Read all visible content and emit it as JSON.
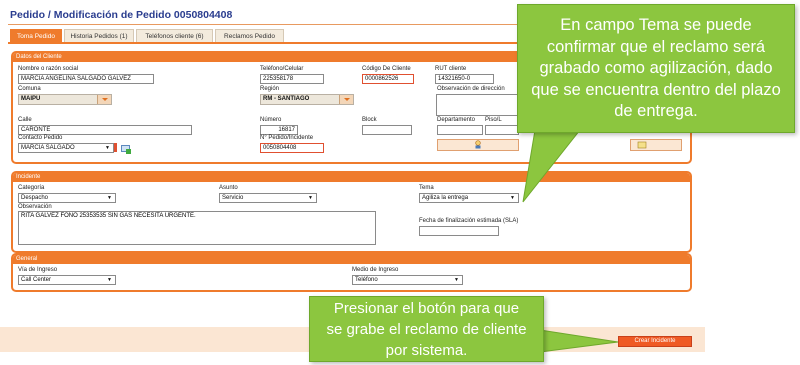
{
  "header": {
    "title": "Pedido / Modificación de Pedido 0050804408"
  },
  "tabs": [
    {
      "label": "Toma Pedido",
      "active": true
    },
    {
      "label": "Historia Pedidos (1)",
      "active": false
    },
    {
      "label": "Teléfonos cliente (6)",
      "active": false
    },
    {
      "label": "Reclamos Pedido",
      "active": false
    }
  ],
  "datos_cliente": {
    "section_title": "Datos del Cliente",
    "nombre_label": "Nombre o razón social",
    "nombre_value": "MARCIA ANGELINA SALGADO GALVEZ",
    "telefono_label": "Teléfono/Celular",
    "telefono_value": "225358178",
    "codigo_label": "Código De Cliente",
    "codigo_value": "0000862526",
    "rut_label": "RUT cliente",
    "rut_value": "14321650-0",
    "comuna_label": "Comuna",
    "comuna_value": "MAIPU",
    "region_label": "Región",
    "region_value": "RM - SANTIAGO",
    "obs_dir_label": "Observación de dirección",
    "calle_label": "Calle",
    "calle_value": "CARONTE",
    "numero_label": "Número",
    "numero_value": "16817",
    "block_label": "Block",
    "depto_label": "Departamento",
    "piso_label": "Piso/L",
    "contacto_label": "Contacto Pedido",
    "contacto_value": "MARCIA SALGADO",
    "pedido_label": "N° Pedido/Incidente",
    "pedido_value": "0050804408"
  },
  "incidente": {
    "section_title": "Incidente",
    "categoria_label": "Categoría",
    "categoria_value": "Despacho",
    "asunto_label": "Asunto",
    "asunto_value": "Servicio",
    "tema_label": "Tema",
    "tema_value": "Agiliza la entrega",
    "observacion_label": "Observación",
    "observacion_value": "RITA GALVEZ FONO 25353535 SIN GAS NECESITA URGENTE.",
    "sla_label": "Fecha de finalización estimada (SLA)"
  },
  "general": {
    "section_title": "General",
    "via_label": "Vía de Ingreso",
    "via_value": "Call Center",
    "medio_label": "Medio de Ingreso",
    "medio_value": "Teléfono"
  },
  "actions": {
    "crear_label": "Crear Incidente"
  },
  "callouts": {
    "tema": "En campo Tema se puede confirmar que el reclamo será grabado como agilización, dado que se encuentra dentro del plazo de entrega.",
    "boton": "Presionar el botón para que se grabe el reclamo de cliente por sistema."
  },
  "colors": {
    "accent": "#ef7b2c",
    "callout": "#8cc63f",
    "title": "#2a3d8f"
  }
}
